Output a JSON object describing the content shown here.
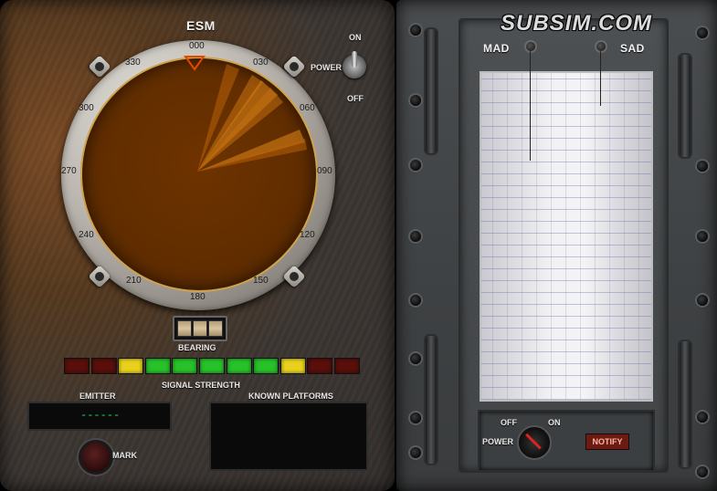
{
  "logo": {
    "text": "SUBSIM.COM"
  },
  "esm": {
    "title": "ESM",
    "bearing_labels": [
      "000",
      "030",
      "060",
      "090",
      "120",
      "150",
      "180",
      "210",
      "240",
      "270",
      "300",
      "330"
    ],
    "bearing_label": "BEARING",
    "bearing_digits": [
      "",
      "",
      ""
    ],
    "signal_strength_label": "SIGNAL STRENGTH",
    "signal_strength_leds": [
      {
        "color": "#5a0f0a"
      },
      {
        "color": "#5a0f0a"
      },
      {
        "color": "#e8d11d"
      },
      {
        "color": "#27c22a"
      },
      {
        "color": "#27c22a"
      },
      {
        "color": "#27c22a"
      },
      {
        "color": "#27c22a"
      },
      {
        "color": "#27c22a"
      },
      {
        "color": "#e8d11d"
      },
      {
        "color": "#5a0f0a"
      },
      {
        "color": "#5a0f0a"
      }
    ],
    "emitter_label": "EMITTER",
    "emitter_value": "------",
    "known_platforms_label": "KNOWN PLATFORMS",
    "mark_label": "MARK",
    "power_on_label": "ON",
    "power_label": "POWER",
    "power_off_label": "OFF"
  },
  "recorder": {
    "mad_label": "MAD",
    "sad_label": "SAD",
    "power_off_label": "OFF",
    "power_on_label": "ON",
    "power_label": "POWER",
    "notify_label": "NOTIFY"
  },
  "colors": {
    "scope": "#5e2c00",
    "scope_rim": "#d0a24c",
    "led_green": "#27c22a",
    "led_yellow": "#e8d11d",
    "led_red": "#5a0f0a"
  }
}
